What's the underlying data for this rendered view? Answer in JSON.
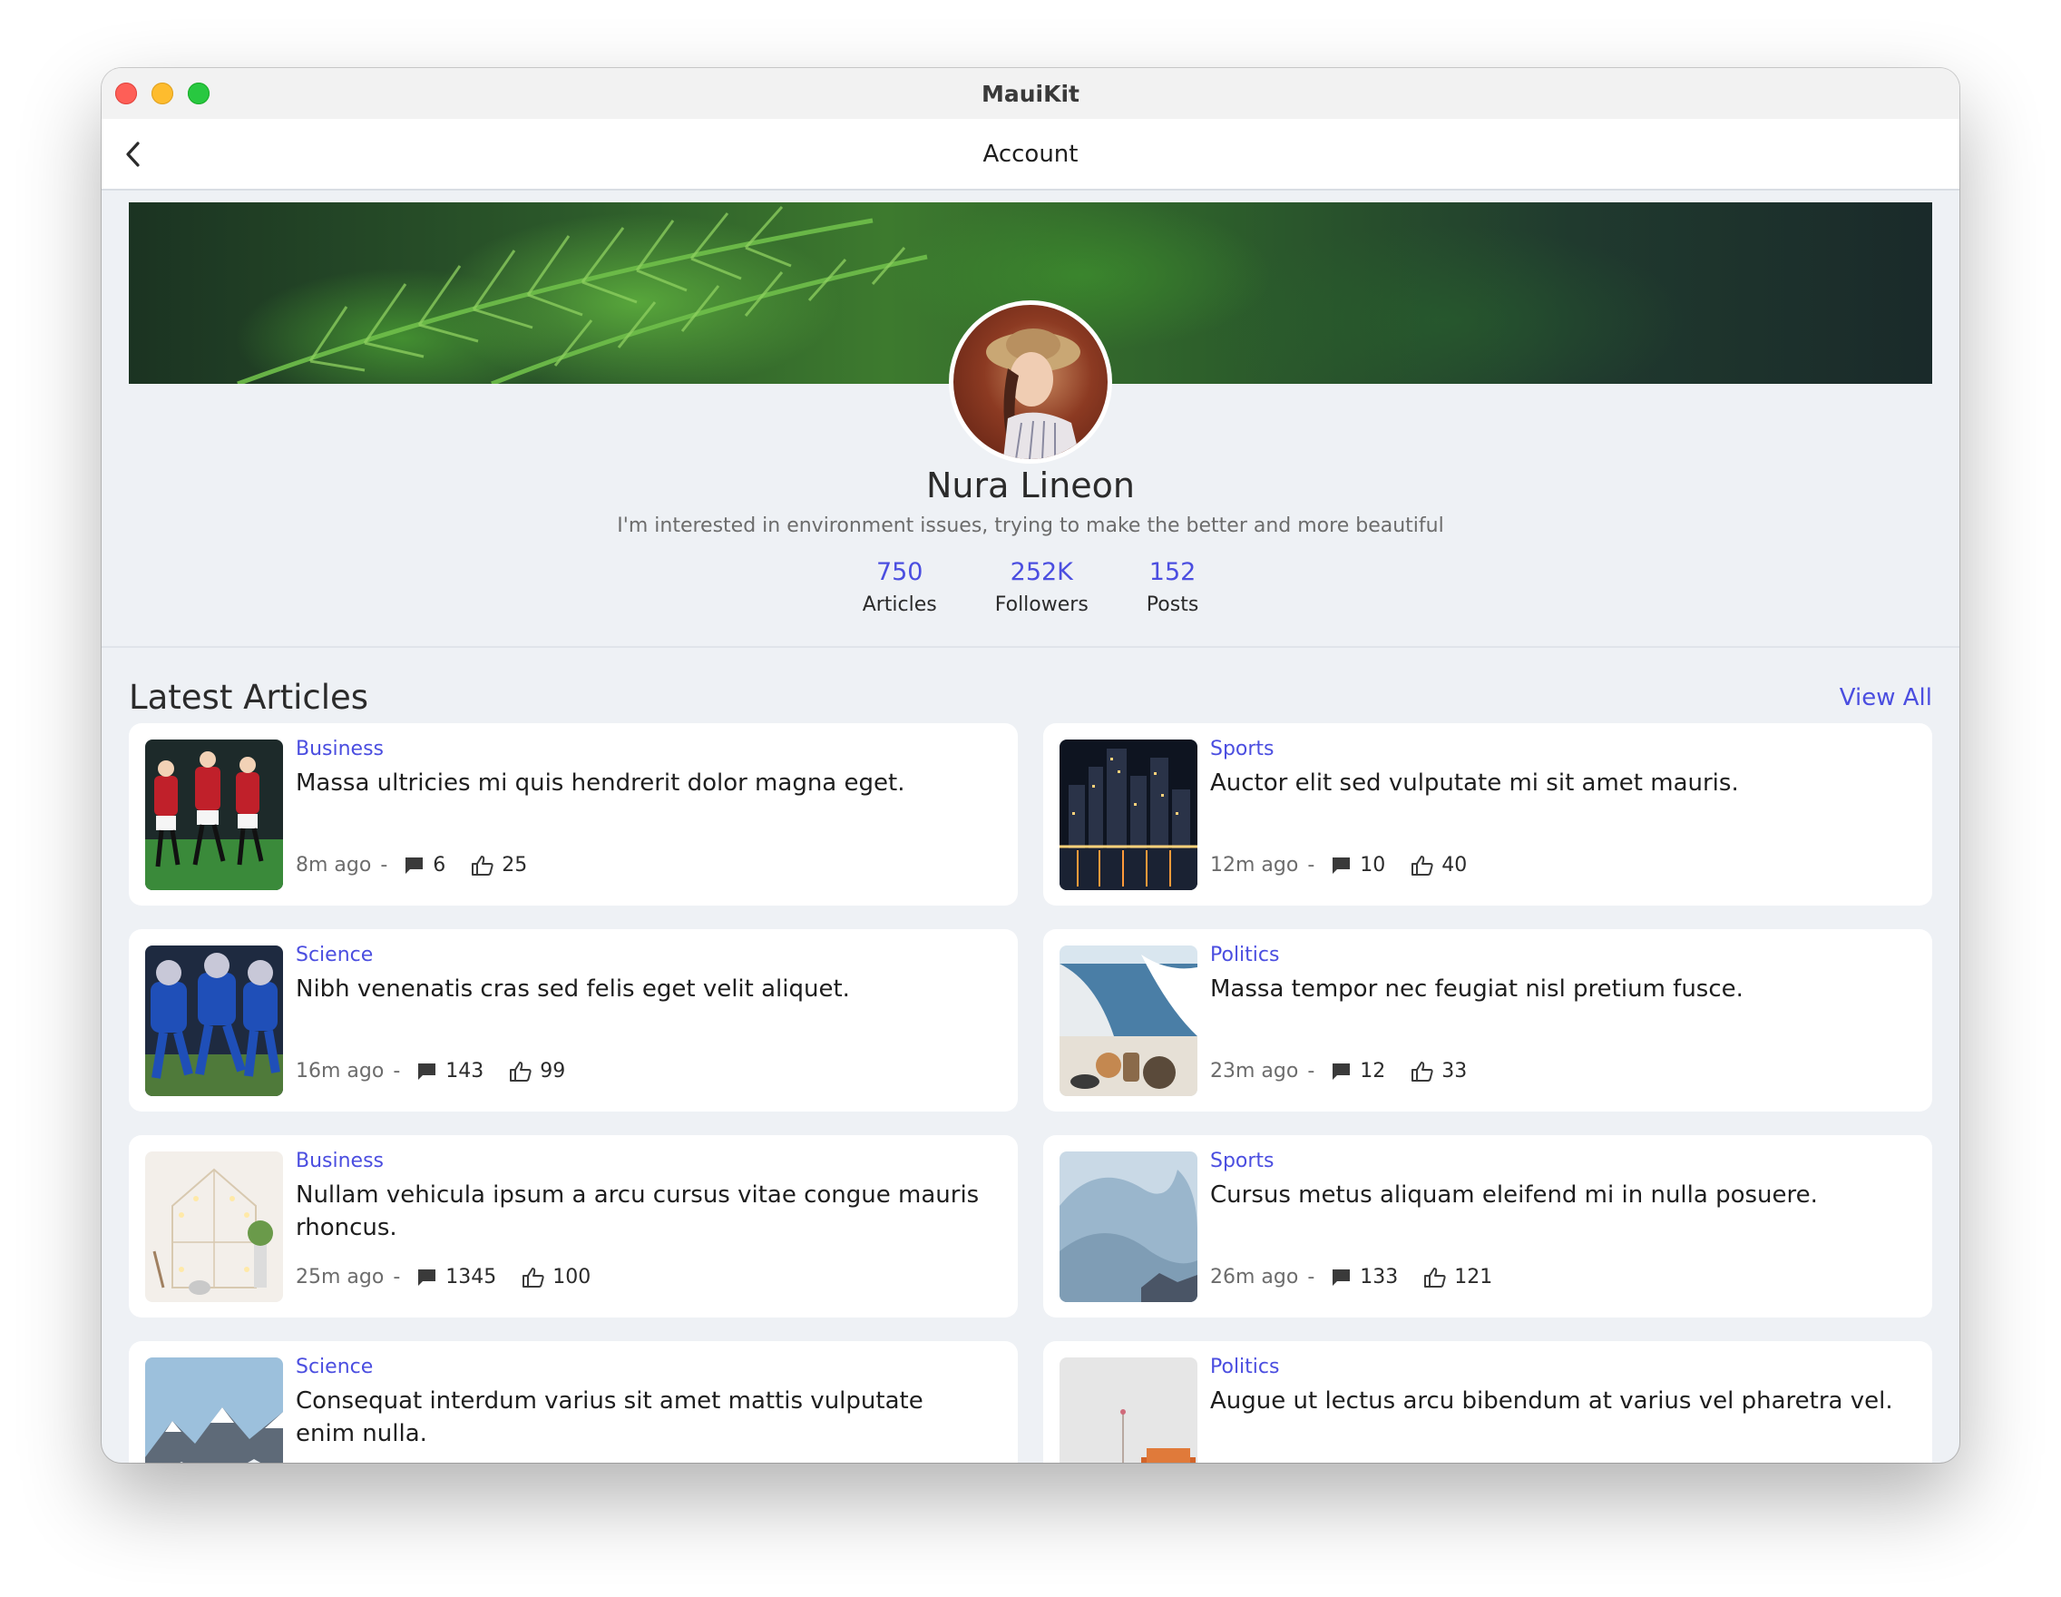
{
  "window": {
    "title": "MauiKit"
  },
  "nav": {
    "title": "Account"
  },
  "profile": {
    "name": "Nura Lineon",
    "bio": "I'm interested in environment issues, trying to make the better and more beautiful",
    "stats": [
      {
        "value": "750",
        "label": "Articles"
      },
      {
        "value": "252K",
        "label": "Followers"
      },
      {
        "value": "152",
        "label": "Posts"
      }
    ]
  },
  "section": {
    "title": "Latest Articles",
    "view_all": "View All"
  },
  "articles": [
    {
      "category": "Business",
      "title": "Massa ultricies mi quis hendrerit dolor magna eget.",
      "time": "8m ago",
      "comments": "6",
      "likes": "25",
      "thumb": "soccer"
    },
    {
      "category": "Sports",
      "title": "Auctor elit sed vulputate mi sit amet mauris.",
      "time": "12m ago",
      "comments": "10",
      "likes": "40",
      "thumb": "city-night"
    },
    {
      "category": "Science",
      "title": "Nibh venenatis cras sed felis eget velit aliquet.",
      "time": "16m ago",
      "comments": "143",
      "likes": "99",
      "thumb": "football"
    },
    {
      "category": "Politics",
      "title": "Massa tempor nec feugiat nisl pretium fusce.",
      "time": "23m ago",
      "comments": "12",
      "likes": "33",
      "thumb": "coast"
    },
    {
      "category": "Business",
      "title": "Nullam vehicula ipsum a arcu cursus vitae congue mauris rhoncus.",
      "time": "25m ago",
      "comments": "1345",
      "likes": "100",
      "thumb": "decor"
    },
    {
      "category": "Sports",
      "title": "Cursus metus aliquam eleifend mi in nulla posuere.",
      "time": "26m ago",
      "comments": "133",
      "likes": "121",
      "thumb": "wave"
    },
    {
      "category": "Science",
      "title": "Consequat interdum varius sit amet mattis vulputate enim nulla.",
      "time": "",
      "comments": "",
      "likes": "",
      "thumb": "mountains"
    },
    {
      "category": "Politics",
      "title": "Augue ut lectus arcu bibendum at varius vel pharetra vel.",
      "time": "",
      "comments": "",
      "likes": "",
      "thumb": "room"
    }
  ],
  "colors": {
    "accent": "#4b4ee0",
    "background": "#eef1f5",
    "card": "#ffffff"
  }
}
